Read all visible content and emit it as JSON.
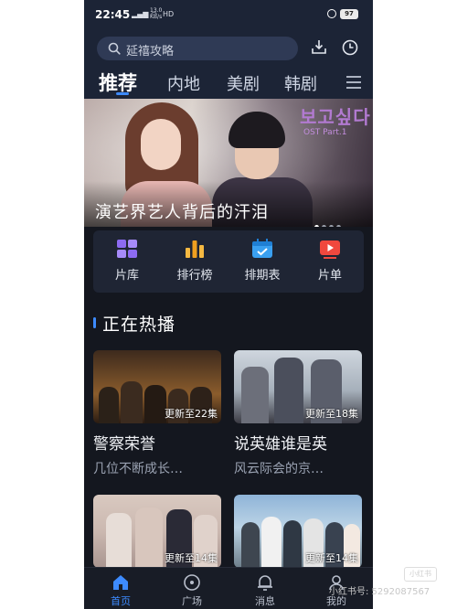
{
  "status": {
    "time": "22:45",
    "net_speed": "13.0 KB/s",
    "hd": "HD",
    "battery": "97"
  },
  "search": {
    "placeholder": "延禧攻略"
  },
  "tabs": [
    {
      "label": "推荐"
    },
    {
      "label": "内地"
    },
    {
      "label": "美剧"
    },
    {
      "label": "韩剧"
    }
  ],
  "banner": {
    "logo": "보고싶다",
    "logo_sub": "OST Part.1",
    "caption": "演艺界艺人背后的汗泪",
    "dots": 4,
    "active_dot": 0
  },
  "quick": [
    {
      "label": "片库",
      "icon": "library-icon"
    },
    {
      "label": "排行榜",
      "icon": "ranking-icon"
    },
    {
      "label": "排期表",
      "icon": "schedule-icon"
    },
    {
      "label": "片单",
      "icon": "playlist-icon"
    }
  ],
  "section": {
    "title": "正在热播"
  },
  "cards": [
    {
      "badge": "更新至22集",
      "title": "警察荣誉",
      "subtitle": "几位不断成长…"
    },
    {
      "badge": "更新至18集",
      "title": "说英雄谁是英",
      "subtitle": "风云际会的京…"
    },
    {
      "badge": "更新至14集",
      "title": "",
      "subtitle": ""
    },
    {
      "badge": "更新至14集",
      "title": "",
      "subtitle": ""
    }
  ],
  "nav": [
    {
      "label": "首页",
      "icon": "home-icon"
    },
    {
      "label": "广场",
      "icon": "plaza-icon"
    },
    {
      "label": "消息",
      "icon": "message-icon"
    },
    {
      "label": "我的",
      "icon": "profile-icon"
    }
  ],
  "watermark": {
    "text": "小红书号: 5292087567",
    "box": "小红书"
  },
  "colors": {
    "accent": "#3d8bff",
    "background": "#14171f",
    "header": "#1c2436"
  }
}
